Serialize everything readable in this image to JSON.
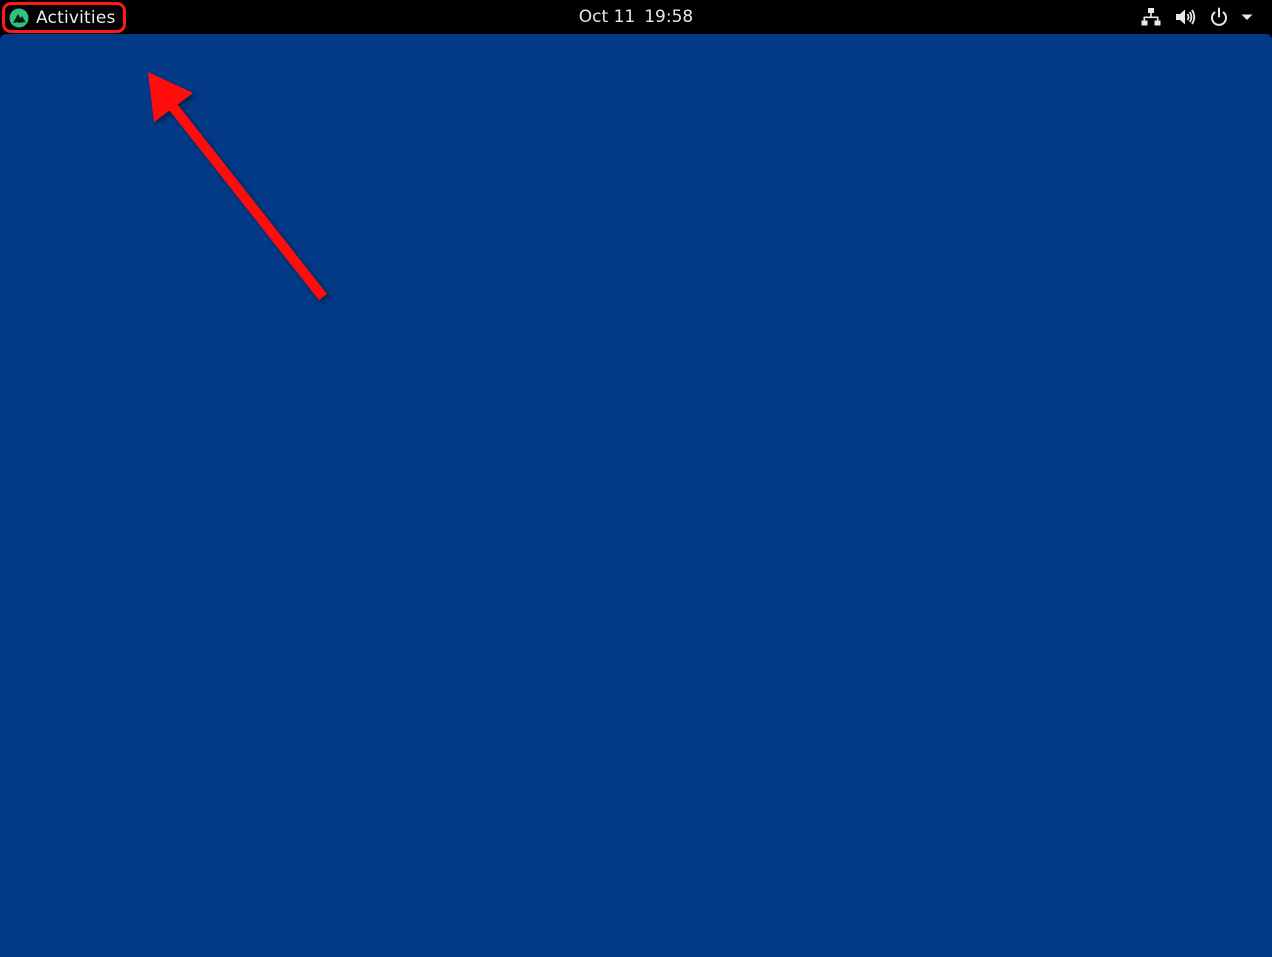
{
  "topbar": {
    "activities_label": "Activities",
    "date": "Oct 11",
    "time": "19:58",
    "icons": [
      "distro-logo-icon",
      "network-icon",
      "volume-icon",
      "power-icon",
      "chevron-down-icon"
    ]
  },
  "colors": {
    "topbar_bg": "#000000",
    "desktop_bg": "#023a87",
    "highlight": "#ff1a1a",
    "logo_green": "#2ec27e"
  }
}
